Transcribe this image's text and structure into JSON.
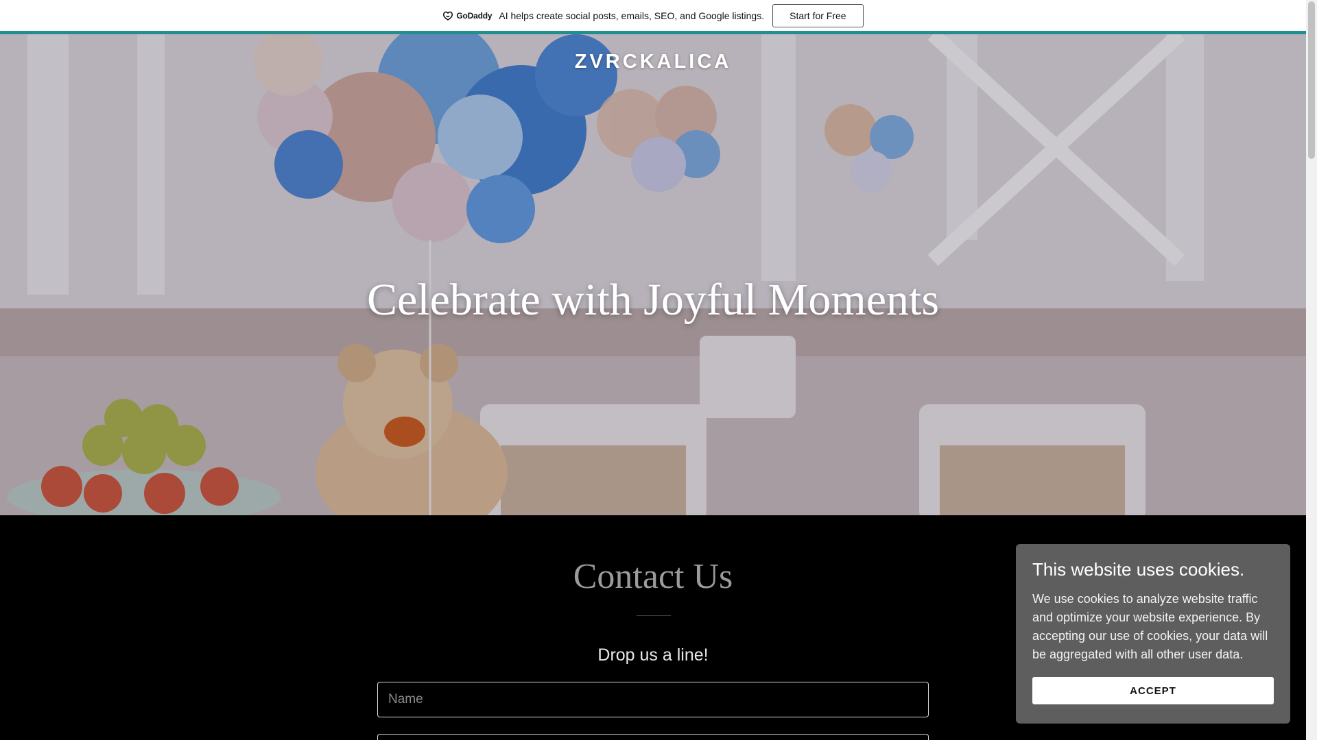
{
  "promo_banner": {
    "logo_text": "GoDaddy",
    "message": "AI helps create social posts, emails, SEO, and Google listings.",
    "cta_label": "Start for Free",
    "accent_color": "#1f8f8f"
  },
  "hero": {
    "site_title": "ZVRCKALICA",
    "headline": "Celebrate with Joyful Moments"
  },
  "contact": {
    "title": "Contact Us",
    "subtitle": "Drop us a line!",
    "name_placeholder": "Name"
  },
  "cookie_banner": {
    "title": "This website uses cookies.",
    "body": "We use cookies to analyze website traffic and optimize your website experience. By accepting our use of cookies, your data will be aggregated with all other user data.",
    "accept_label": "ACCEPT",
    "background_color": "#5e5e5e"
  }
}
